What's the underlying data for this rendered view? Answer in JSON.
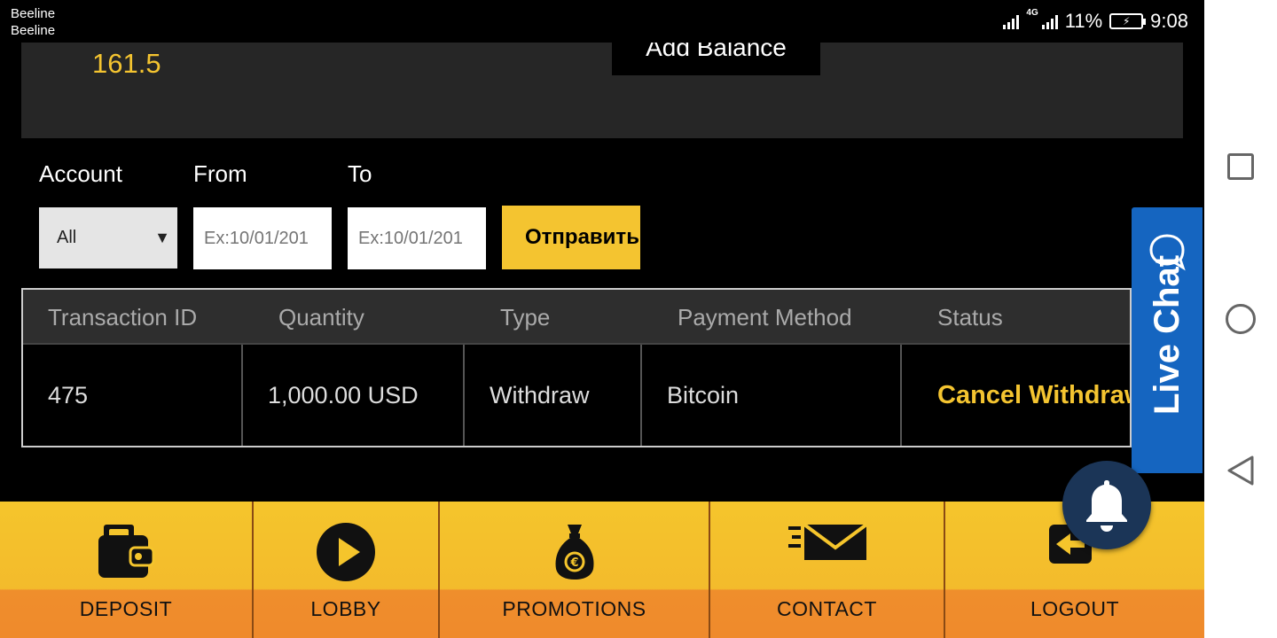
{
  "status_bar": {
    "carrier_1": "Beeline",
    "carrier_2": "Beeline",
    "network": "4G",
    "battery_percent": "11%",
    "time": "9:08"
  },
  "balance": {
    "amount": "161.5",
    "add_balance_label": "Add Balance"
  },
  "filter": {
    "account_label": "Account",
    "from_label": "From",
    "to_label": "To",
    "account_selected": "All",
    "from_placeholder": "Ex:10/01/201",
    "to_placeholder": "Ex:10/01/201",
    "submit_label": "Отправить"
  },
  "table": {
    "headers": [
      "Transaction ID",
      "Quantity",
      "Type",
      "Payment Method",
      "Status"
    ],
    "rows": [
      {
        "id": "475",
        "quantity": "1,000.00 USD",
        "type": "Withdraw",
        "method": "Bitcoin",
        "status": "Cancel Withdraw"
      }
    ]
  },
  "live_chat": {
    "label": "Live Chat"
  },
  "bottom_nav": {
    "items": [
      {
        "label": "DEPOSIT",
        "icon": "wallet-icon"
      },
      {
        "label": "LOBBY",
        "icon": "play-icon"
      },
      {
        "label": "PROMOTIONS",
        "icon": "money-bag-icon"
      },
      {
        "label": "CONTACT",
        "icon": "envelope-icon"
      },
      {
        "label": "LOGOUT",
        "icon": "logout-icon"
      }
    ]
  },
  "colors": {
    "accent_yellow": "#f4c430",
    "nav_orange": "#ef8e2c",
    "live_chat_blue": "#1565c0",
    "bell_navy": "#1b3557"
  }
}
